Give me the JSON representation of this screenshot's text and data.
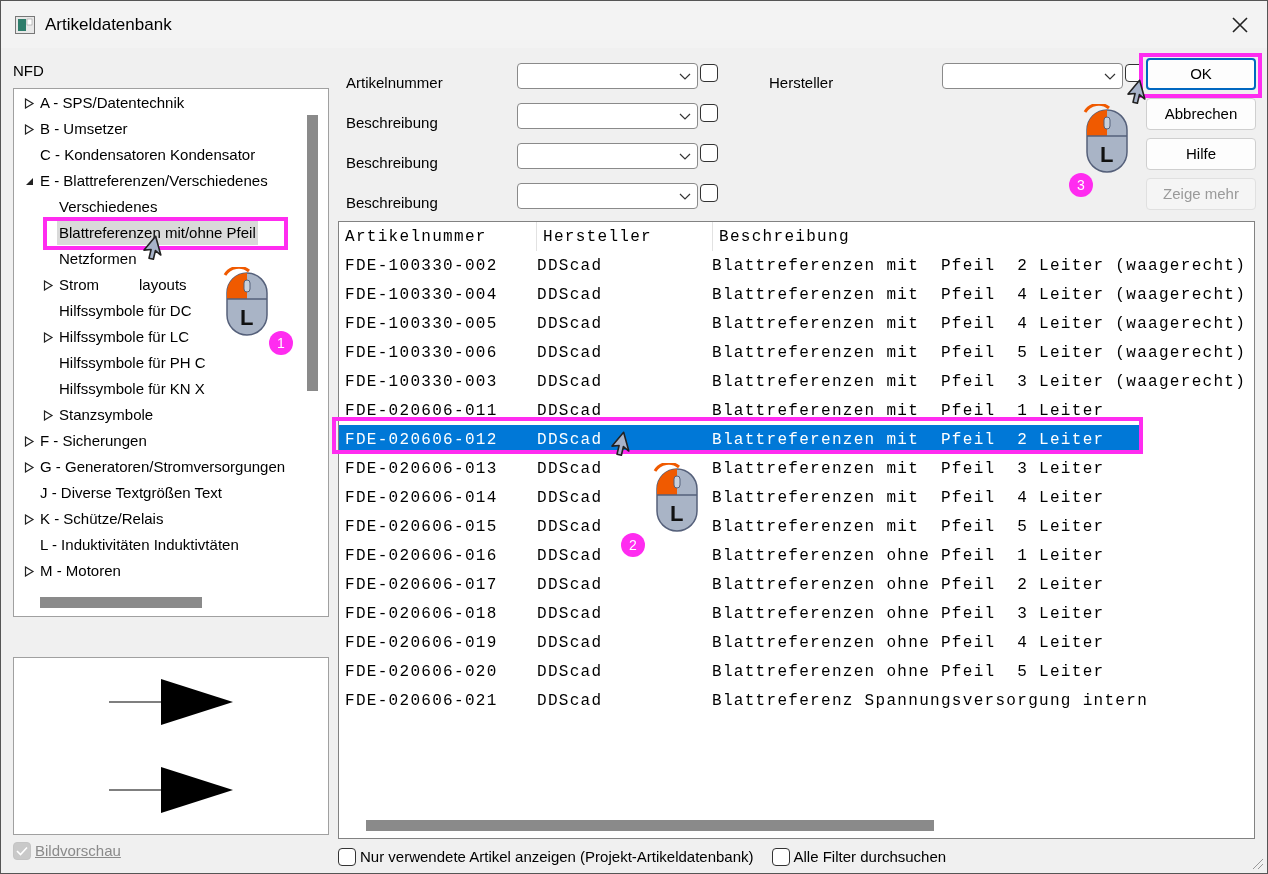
{
  "window": {
    "title": "Artikeldatenbank"
  },
  "tree": {
    "title": "NFD",
    "items": [
      {
        "label": "A - SPS/Datentechnik",
        "expandable": true,
        "expanded": false,
        "selected": false
      },
      {
        "label": "B - Umsetzer",
        "expandable": true,
        "expanded": false,
        "selected": false
      },
      {
        "label": "C - Kondensatoren Kondensator",
        "expandable": false,
        "selected": false
      },
      {
        "label": "E - Blattreferenzen/Verschiedenes",
        "expandable": true,
        "expanded": true,
        "selected": false,
        "children": [
          {
            "label": "Verschiedenes",
            "expandable": false,
            "selected": false
          },
          {
            "label": "Blattreferenzen mit/ohne Pfeil",
            "expandable": false,
            "selected": true
          },
          {
            "label": "Netzformen",
            "expandable": false,
            "selected": false
          },
          {
            "label": "Strom",
            "label_after": "layouts",
            "expandable": true,
            "expanded": false,
            "selected": false
          },
          {
            "label": "Hilfssymbole für DC",
            "expandable": false,
            "selected": false
          },
          {
            "label": "Hilfssymbole für LC",
            "expandable": true,
            "expanded": false,
            "selected": false
          },
          {
            "label": "Hilfssymbole für PH C",
            "expandable": false,
            "selected": false
          },
          {
            "label": "Hilfssymbole für KN X",
            "expandable": false,
            "selected": false
          },
          {
            "label": "Stanzsymbole",
            "expandable": true,
            "expanded": false,
            "selected": false
          }
        ]
      },
      {
        "label": "F - Sicherungen",
        "expandable": true,
        "expanded": false,
        "selected": false
      },
      {
        "label": "G - Generatoren/Stromversorgungen",
        "expandable": true,
        "expanded": false,
        "selected": false
      },
      {
        "label": "J - Diverse Textgrößen Text",
        "expandable": false,
        "selected": false
      },
      {
        "label": "K - Schütze/Relais",
        "expandable": true,
        "expanded": false,
        "selected": false
      },
      {
        "label": "L - Induktivitäten Induktivtäten",
        "expandable": false,
        "selected": false
      },
      {
        "label": "M - Motoren",
        "expandable": true,
        "expanded": false,
        "selected": false
      }
    ]
  },
  "preview": {
    "checkbox": {
      "label": "Bildvorschau",
      "checked": true,
      "disabled": true
    }
  },
  "filters": [
    {
      "label": "Artikelnummer",
      "checked": false
    },
    {
      "label": "Beschreibung",
      "checked": false
    },
    {
      "label": "Beschreibung",
      "checked": false
    },
    {
      "label": "Beschreibung",
      "checked": false
    },
    {
      "label": "Hersteller",
      "checked": false
    }
  ],
  "buttons": [
    {
      "label": "OK",
      "focused": true,
      "disabled": false
    },
    {
      "label": "Abbrechen",
      "focused": false,
      "disabled": false
    },
    {
      "label": "Hilfe",
      "focused": false,
      "disabled": false
    },
    {
      "label": "Zeige mehr",
      "focused": false,
      "disabled": true
    }
  ],
  "table": {
    "columns": [
      "Artikelnummer",
      "Hersteller",
      "Beschreibung"
    ],
    "rows": [
      {
        "cells": [
          "FDE-100330-002",
          "DDScad",
          "Blattreferenzen mit  Pfeil  2 Leiter (waagerecht)"
        ],
        "selected": false
      },
      {
        "cells": [
          "FDE-100330-004",
          "DDScad",
          "Blattreferenzen mit  Pfeil  4 Leiter (waagerecht)"
        ],
        "selected": false
      },
      {
        "cells": [
          "FDE-100330-005",
          "DDScad",
          "Blattreferenzen mit  Pfeil  4 Leiter (waagerecht)"
        ],
        "selected": false
      },
      {
        "cells": [
          "FDE-100330-006",
          "DDScad",
          "Blattreferenzen mit  Pfeil  5 Leiter (waagerecht)"
        ],
        "selected": false
      },
      {
        "cells": [
          "FDE-100330-003",
          "DDScad",
          "Blattreferenzen mit  Pfeil  3 Leiter (waagerecht)"
        ],
        "selected": false
      },
      {
        "cells": [
          "FDE-020606-011",
          "DDScad",
          "Blattreferenzen mit  Pfeil  1 Leiter"
        ],
        "selected": false
      },
      {
        "cells": [
          "FDE-020606-012",
          "DDScad",
          "Blattreferenzen mit  Pfeil  2 Leiter"
        ],
        "selected": true
      },
      {
        "cells": [
          "FDE-020606-013",
          "DDScad",
          "Blattreferenzen mit  Pfeil  3 Leiter"
        ],
        "selected": false
      },
      {
        "cells": [
          "FDE-020606-014",
          "DDScad",
          "Blattreferenzen mit  Pfeil  4 Leiter"
        ],
        "selected": false
      },
      {
        "cells": [
          "FDE-020606-015",
          "DDScad",
          "Blattreferenzen mit  Pfeil  5 Leiter"
        ],
        "selected": false
      },
      {
        "cells": [
          "FDE-020606-016",
          "DDScad",
          "Blattreferenzen ohne Pfeil  1 Leiter"
        ],
        "selected": false
      },
      {
        "cells": [
          "FDE-020606-017",
          "DDScad",
          "Blattreferenzen ohne Pfeil  2 Leiter"
        ],
        "selected": false
      },
      {
        "cells": [
          "FDE-020606-018",
          "DDScad",
          "Blattreferenzen ohne Pfeil  3 Leiter"
        ],
        "selected": false
      },
      {
        "cells": [
          "FDE-020606-019",
          "DDScad",
          "Blattreferenzen ohne Pfeil  4 Leiter"
        ],
        "selected": false
      },
      {
        "cells": [
          "FDE-020606-020",
          "DDScad",
          "Blattreferenzen ohne Pfeil  5 Leiter"
        ],
        "selected": false
      },
      {
        "cells": [
          "FDE-020606-021",
          "DDScad",
          "Blattreferenz Spannungsversorgung intern"
        ],
        "selected": false
      }
    ]
  },
  "options": [
    {
      "label": "Nur verwendete Artikel anzeigen (Projekt-Artikeldatenbank)",
      "checked": false
    },
    {
      "label": "Alle Filter durchsuchen",
      "checked": false
    }
  ],
  "annotations": [
    {
      "number": "1",
      "button": "L"
    },
    {
      "number": "2",
      "button": "L"
    },
    {
      "number": "3",
      "button": "L"
    }
  ]
}
